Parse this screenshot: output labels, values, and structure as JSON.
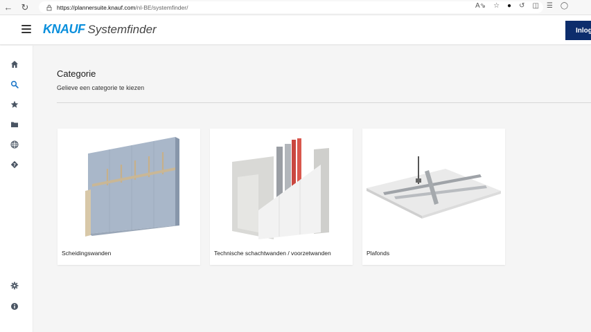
{
  "browser": {
    "url_host": "https://plannersuite.knauf.com",
    "url_path": "/nl-BE/systemfinder/"
  },
  "header": {
    "logo_brand": "KNAUF",
    "logo_product": "Systemfinder",
    "login_label": "Inlog"
  },
  "sidebar": {
    "items": [
      "home",
      "search",
      "favorites",
      "folder",
      "language",
      "help",
      "settings",
      "info"
    ]
  },
  "main": {
    "title": "Categorie",
    "subtitle": "Gelieve een categorie te kiezen",
    "categories": [
      {
        "label": "Scheidingswanden"
      },
      {
        "label": "Technische schachtwanden / voorzetwanden"
      },
      {
        "label": "Plafonds"
      }
    ]
  },
  "colors": {
    "brand_blue": "#0a8fdc",
    "login_bg": "#0d2d6c",
    "active_icon": "#1f78c8"
  }
}
